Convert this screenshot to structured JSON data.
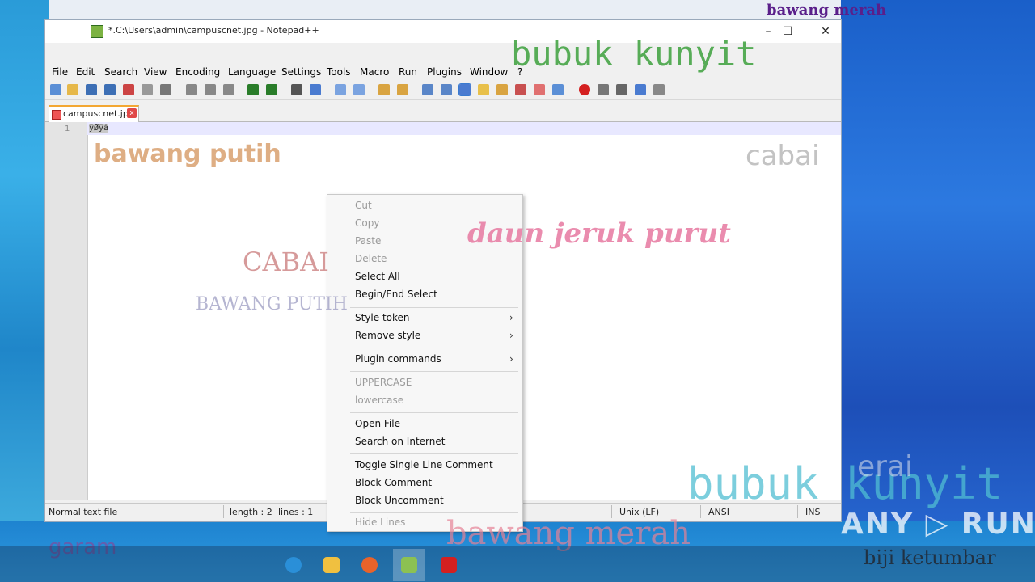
{
  "window": {
    "title": "*.C:\\Users\\admin\\campuscnet.jpg - Notepad++",
    "minimize_label": "–",
    "maximize_label": "☐",
    "close_label": "✕"
  },
  "menubar": [
    "File",
    "Edit",
    "Search",
    "View",
    "Encoding",
    "Language",
    "Settings",
    "Tools",
    "Macro",
    "Run",
    "Plugins",
    "Window",
    "?"
  ],
  "tab": {
    "label": "campuscnet.jpg",
    "close": "x"
  },
  "editor": {
    "line_number": "1",
    "content": "ÿØÿà"
  },
  "context_menu": {
    "items": [
      {
        "label": "Cut",
        "disabled": true
      },
      {
        "label": "Copy",
        "disabled": true
      },
      {
        "label": "Paste",
        "disabled": true
      },
      {
        "label": "Delete",
        "disabled": true
      },
      {
        "label": "Select All",
        "disabled": false
      },
      {
        "label": "Begin/End Select",
        "disabled": false
      },
      {
        "label": "Style token",
        "disabled": false,
        "submenu": true
      },
      {
        "label": "Remove style",
        "disabled": false,
        "submenu": true
      },
      {
        "label": "Plugin commands",
        "disabled": false,
        "submenu": true
      },
      {
        "label": "UPPERCASE",
        "disabled": true
      },
      {
        "label": "lowercase",
        "disabled": true
      },
      {
        "label": "Open File",
        "disabled": false
      },
      {
        "label": "Search on Internet",
        "disabled": false
      },
      {
        "label": "Toggle Single Line Comment",
        "disabled": false
      },
      {
        "label": "Block Comment",
        "disabled": false
      },
      {
        "label": "Block Uncomment",
        "disabled": false
      },
      {
        "label": "Hide Lines",
        "disabled": true
      }
    ],
    "submenu_arrow": "›"
  },
  "statusbar": {
    "file_type": "Normal text file",
    "length": "length : 2",
    "lines": "lines : 1",
    "eol": "Unix (LF)",
    "encoding": "ANSI",
    "mode": "INS"
  },
  "background_words": [
    "bawang merah",
    "bubuk kunyit",
    "bawang putih",
    "cabai",
    "daun jeruk purut",
    "CABAI",
    "BAWANG PUTIH",
    "bawang merah",
    "biji ketumbar",
    "garam",
    "bubuk kunyit",
    "erai"
  ],
  "watermark": "ANY ▷ RUN"
}
